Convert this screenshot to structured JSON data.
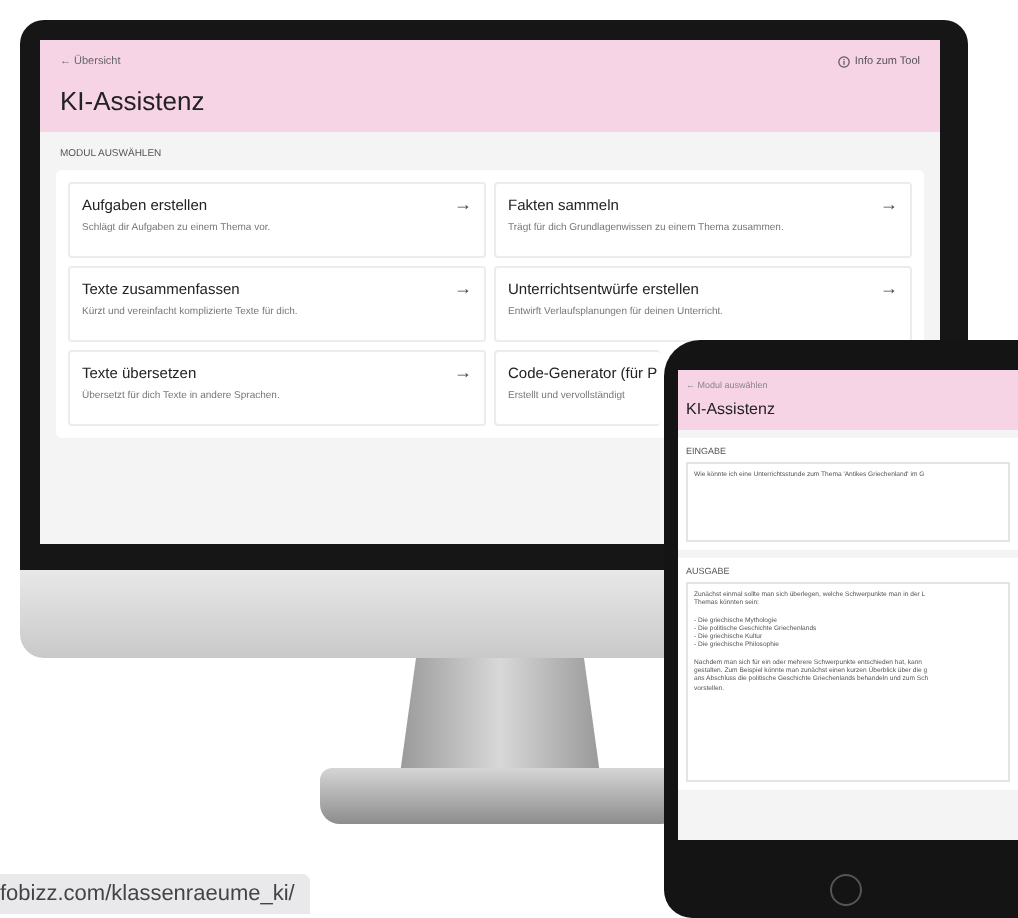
{
  "monitor": {
    "back_link": "← Übersicht",
    "info_link": "Info zum Tool",
    "title": "KI-Assistenz",
    "section_label": "MODUL AUSWÄHLEN",
    "modules": [
      {
        "title": "Aufgaben erstellen",
        "description": "Schlägt dir Aufgaben zu einem Thema vor.",
        "arrow": "→"
      },
      {
        "title": "Fakten sammeln",
        "description": "Trägt für dich Grundlagenwissen zu einem Thema zusammen.",
        "arrow": "→"
      },
      {
        "title": "Texte zusammenfassen",
        "description": "Kürzt und vereinfacht komplizierte Texte für dich.",
        "arrow": "→"
      },
      {
        "title": "Unterrichtsentwürfe erstellen",
        "description": "Entwirft Verlaufsplanungen für deinen Unterricht.",
        "arrow": "→"
      },
      {
        "title": "Texte übersetzen",
        "description": "Übersetzt für dich Texte in andere Sprachen.",
        "arrow": "→"
      },
      {
        "title": "Code-Generator (für P",
        "description": "Erstellt und vervollständigt"
      }
    ]
  },
  "tablet": {
    "back_link": "← Modul auswählen",
    "title": "KI-Assistenz",
    "input_label": "EINGABE",
    "input_text": "Wie könnte ich eine Unterrichtsstunde zum Thema 'Antikes Griechenland' im G",
    "output_label": "AUSGABE",
    "output_blocks": [
      {
        "lines": [
          "Zunächst einmal sollte man sich überlegen, welche Schwerpunkte man in der L",
          "Themas könnten sein:"
        ]
      },
      {
        "lines": [
          "- Die griechische Mythologie",
          "- Die politische Geschichte Griechenlands",
          "- Die griechische Kultur",
          "- Die griechische Philosophie"
        ]
      },
      {
        "lines": [
          "Nachdem man sich für ein oder mehrere Schwerpunkte entschieden hat, kann",
          "gestalten. Zum Beispiel könnte man zunächst einen kurzen Überblick über die g",
          "ans Abschluss die politische Geschichte Griechenlands behandeln und zum Sch",
          "vorstellen."
        ]
      }
    ]
  },
  "url_chip": "fobizz.com/klassenraeume_ki/"
}
